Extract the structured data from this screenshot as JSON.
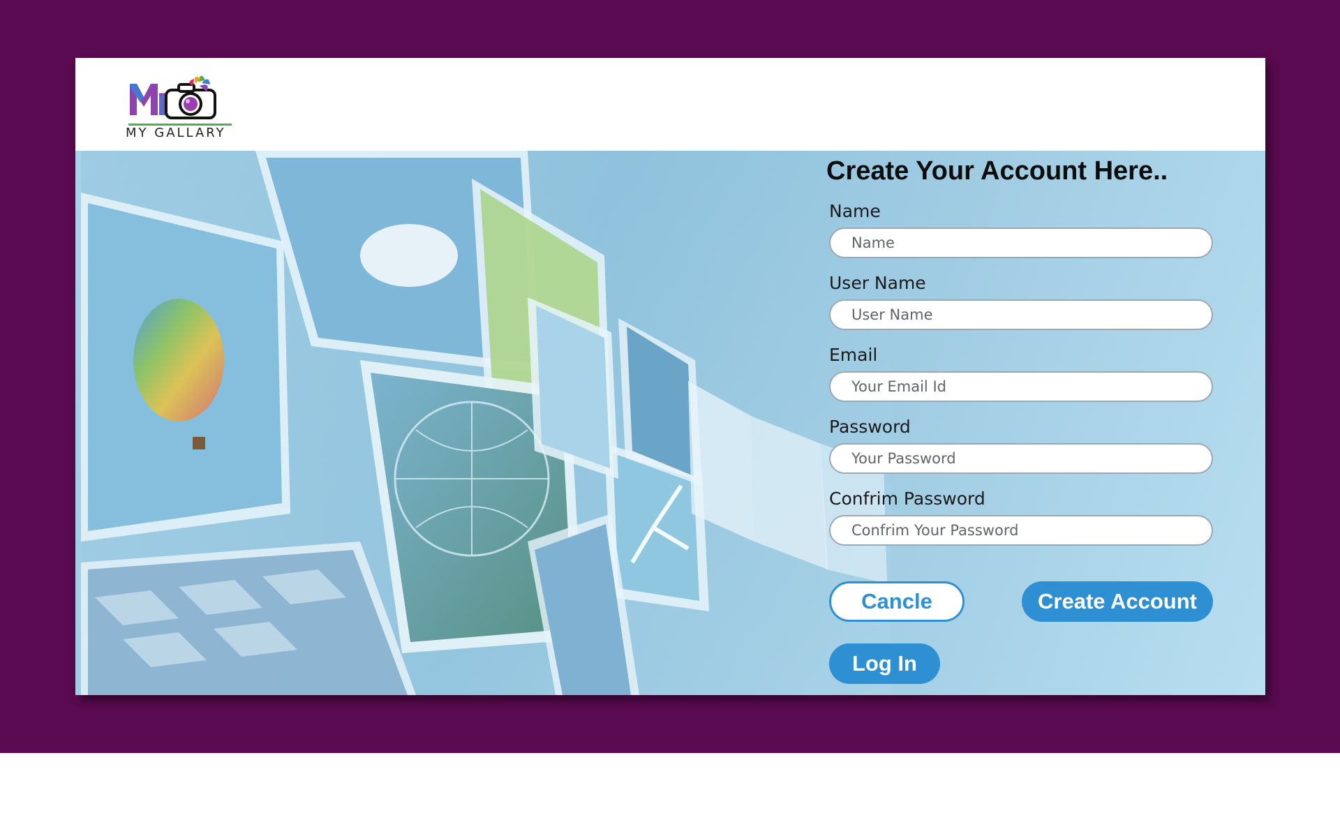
{
  "brand": {
    "name": "MY GALLARY",
    "colors": {
      "logo_purple": "#8e44ad",
      "logo_blue": "#3b7fd4",
      "logo_green": "#4caf50",
      "logo_accent_orange": "#f39c12",
      "logo_accent_pink": "#e91e63"
    }
  },
  "theme": {
    "outer_background": "#5a0a50",
    "card_background": "#ffffff",
    "hero_background": "#9fcde4",
    "accent": "#2e8fd3",
    "text_dark": "#0d0d0d"
  },
  "form": {
    "title": "Create Your Account Here..",
    "fields": [
      {
        "label": "Name",
        "placeholder": "Name",
        "value": ""
      },
      {
        "label": "User Name",
        "placeholder": "User Name",
        "value": ""
      },
      {
        "label": "Email",
        "placeholder": "Your Email Id",
        "value": ""
      },
      {
        "label": "Password",
        "placeholder": "Your Password",
        "value": ""
      },
      {
        "label": "Confrim Password",
        "placeholder": "Confrim Your Password",
        "value": ""
      }
    ],
    "buttons": {
      "cancel": "Cancle",
      "create": "Create Account",
      "login": "Log In"
    }
  },
  "icons": {
    "logo": "camera-logo-icon",
    "hero": "photo-gallery-hero-image"
  }
}
